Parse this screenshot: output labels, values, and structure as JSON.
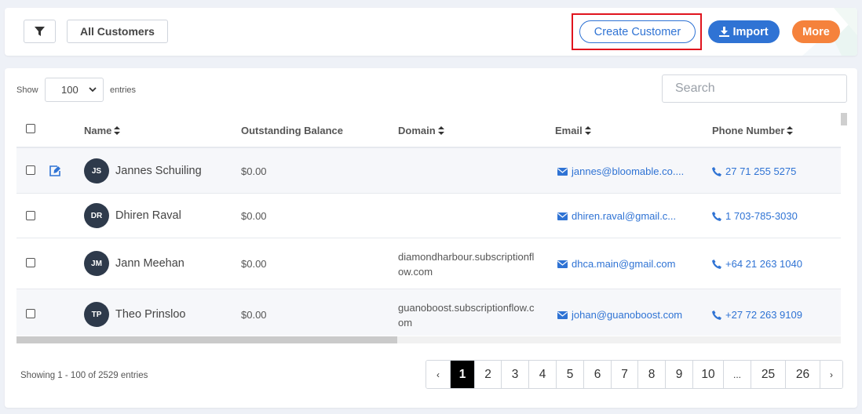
{
  "toolbar": {
    "all_customers_label": "All Customers",
    "create_customer_label": "Create Customer",
    "import_label": "Import",
    "more_label": "More"
  },
  "controls": {
    "show_label": "Show",
    "entries_value": "100",
    "entries_label": "entries",
    "search_placeholder": "Search"
  },
  "table": {
    "columns": [
      "Name",
      "Outstanding Balance",
      "Domain",
      "Email",
      "Phone Number"
    ],
    "rows": [
      {
        "initials": "JS",
        "name": "Jannes Schuiling",
        "balance": "$0.00",
        "domain": "",
        "email": "jannes@bloomable.co....",
        "phone": "27 71 255 5275"
      },
      {
        "initials": "DR",
        "name": "Dhiren Raval",
        "balance": "$0.00",
        "domain": "",
        "email": "dhiren.raval@gmail.c...",
        "phone": "1 703-785-3030"
      },
      {
        "initials": "JM",
        "name": "Jann Meehan",
        "balance": "$0.00",
        "domain": "diamondharbour.subscriptionflow.com",
        "email": "dhca.main@gmail.com",
        "phone": "+64 21 263 1040"
      },
      {
        "initials": "TP",
        "name": "Theo Prinsloo",
        "balance": "$0.00",
        "domain": "guanoboost.subscriptionflow.com",
        "email": "johan@guanoboost.com",
        "phone": "+27 72 263 9109"
      }
    ]
  },
  "footer": {
    "showing_text": "Showing 1 - 100 of 2529 entries",
    "pages": [
      "‹",
      "1",
      "2",
      "3",
      "4",
      "5",
      "6",
      "7",
      "8",
      "9",
      "10",
      "...",
      "25",
      "26",
      "›"
    ],
    "active_page": "1"
  },
  "colors": {
    "accent": "#2f73d4",
    "more": "#f5823c",
    "highlight": "#e0141e",
    "avatar": "#2e3a4b"
  }
}
